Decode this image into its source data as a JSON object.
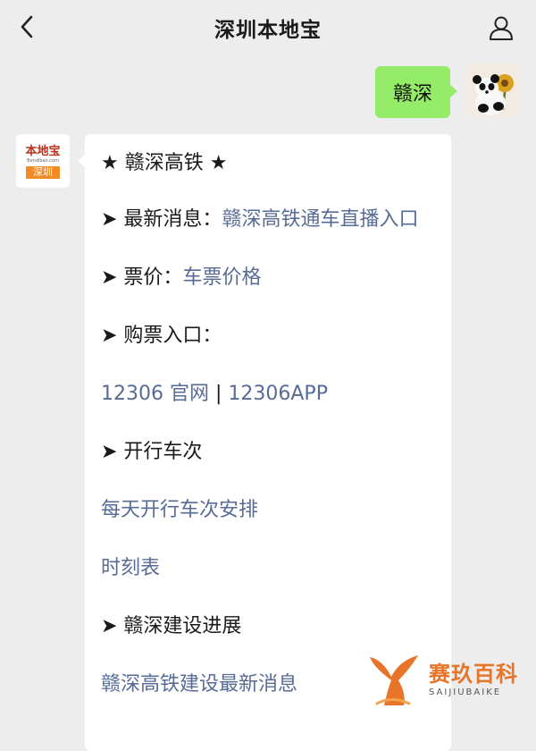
{
  "header": {
    "title": "深圳本地宝"
  },
  "outgoing_message": {
    "text": "赣深"
  },
  "sender": {
    "logo_text": "本地宝",
    "logo_url": "Bendibao.com",
    "logo_city": "深圳"
  },
  "message": {
    "heading": "★ 赣深高铁 ★",
    "news_label": "➤ 最新消息：",
    "news_link": "赣深高铁通车直播入口",
    "price_label": "➤ 票价：",
    "price_link": "车票价格",
    "purchase_label": "➤ 购票入口：",
    "official_site_link": "12306 官网",
    "separator": " | ",
    "app_link": "12306APP",
    "trains_label": "➤ 开行车次",
    "daily_trains_link": "每天开行车次安排",
    "timetable_link": "时刻表",
    "construction_label": "➤ 赣深建设进展",
    "construction_link": "赣深高铁建设最新消息"
  },
  "watermark": {
    "brand_cn": "赛玖百科",
    "brand_en": "SAIJIUBAIKE"
  },
  "colors": {
    "background": "#ededed",
    "outgoing_bubble": "#95ec69",
    "link": "#576b95",
    "watermark": "#e8742a"
  }
}
